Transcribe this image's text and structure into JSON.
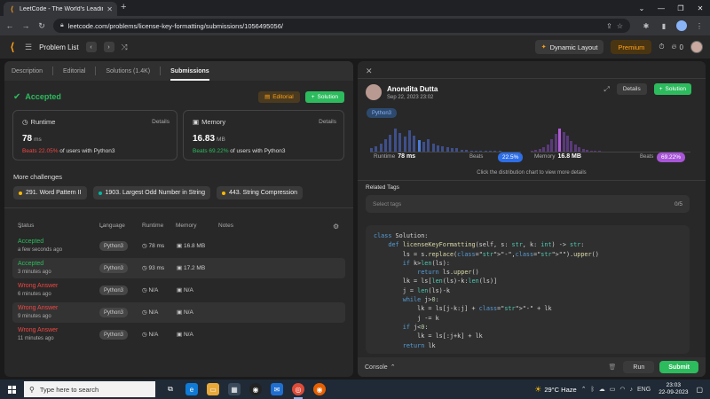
{
  "browser": {
    "tab_title": "LeetCode - The World's Leading",
    "url": "leetcode.com/problems/license-key-formatting/submissions/1056495056/"
  },
  "header": {
    "problem_list": "Problem List",
    "dynamic_layout": "Dynamic Layout",
    "premium": "Premium",
    "streak": "0"
  },
  "left": {
    "tabs": [
      "Description",
      "Editorial",
      "Solutions (1.4K)",
      "Submissions"
    ],
    "status": "Accepted",
    "editorial_btn": "Editorial",
    "solution_btn": "Solution",
    "runtime": {
      "label": "Runtime",
      "details": "Details",
      "value": "78",
      "unit": "ms",
      "beats_pct": "Beats 22.05%",
      "beats_rest": "of users with Python3"
    },
    "memory": {
      "label": "Memory",
      "details": "Details",
      "value": "16.83",
      "unit": "MB",
      "beats_pct": "Beats 69.22%",
      "beats_rest": "of users with Python3"
    },
    "more_title": "More challenges",
    "challenges": [
      {
        "label": "291. Word Pattern II",
        "color": "#ffb800"
      },
      {
        "label": "1903. Largest Odd Number in String",
        "color": "#00b8a3"
      },
      {
        "label": "443. String Compression",
        "color": "#ffb800"
      }
    ],
    "table_headers": {
      "status": "Status",
      "language": "Language",
      "runtime": "Runtime",
      "memory": "Memory",
      "notes": "Notes"
    },
    "rows": [
      {
        "status": "Accepted",
        "time": "a few seconds ago",
        "lang": "Python3",
        "runtime": "78 ms",
        "memory": "16.8 MB",
        "ok": "true"
      },
      {
        "status": "Accepted",
        "time": "3 minutes ago",
        "lang": "Python3",
        "runtime": "93 ms",
        "memory": "17.2 MB",
        "ok": "true"
      },
      {
        "status": "Wrong Answer",
        "time": "6 minutes ago",
        "lang": "Python3",
        "runtime": "N/A",
        "memory": "N/A",
        "ok": "false"
      },
      {
        "status": "Wrong Answer",
        "time": "9 minutes ago",
        "lang": "Python3",
        "runtime": "N/A",
        "memory": "N/A",
        "ok": "false"
      },
      {
        "status": "Wrong Answer",
        "time": "11 minutes ago",
        "lang": "Python3",
        "runtime": "N/A",
        "memory": "N/A",
        "ok": "false"
      }
    ]
  },
  "right": {
    "author": "Anondita Dutta",
    "date": "Sep 22, 2023 23:02",
    "details_btn": "Details",
    "solution_btn": "Solution",
    "lang_badge": "Python3",
    "runtime_label": "Runtime",
    "runtime_value": "78 ms",
    "runtime_beats_label": "Beats",
    "runtime_beats": "22.5%",
    "memory_label": "Memory",
    "memory_value": "16.8 MB",
    "memory_beats_label": "Beats",
    "memory_beats": "69.22%",
    "click_note": "Click the distribution chart to view more details",
    "related_tags": "Related Tags",
    "tags_placeholder": "Select tags",
    "tags_count": "0/5",
    "console": "Console",
    "run": "Run",
    "submit": "Submit",
    "runtime_dist": [
      3,
      5,
      8,
      12,
      16,
      22,
      18,
      14,
      20,
      15,
      11,
      9,
      12,
      8,
      6,
      5,
      4,
      3,
      3,
      2,
      2,
      1,
      1,
      1,
      1,
      1,
      1,
      1
    ],
    "runtime_highlight": 10,
    "memory_dist": [
      1,
      2,
      3,
      5,
      8,
      14,
      20,
      26,
      22,
      18,
      12,
      8,
      5,
      3,
      2,
      1,
      1,
      1
    ],
    "memory_highlight": 7,
    "code_lines": [
      "class Solution:",
      "    def licenseKeyFormatting(self, s: str, k: int) -> str:",
      "        ls = s.replace(\"-\",\"\").upper()",
      "        if k>len(ls):",
      "            return ls.upper()",
      "        lk = ls[len(ls)-k:len(ls)]",
      "        j = len(ls)-k",
      "        while j>0:",
      "            lk = ls[j-k:j] + \"-\" + lk",
      "            j -= k",
      "        if j<0:",
      "            lk = ls[:j+k] + lk",
      "        return lk"
    ]
  },
  "taskbar": {
    "search_placeholder": "Type here to search",
    "weather": "29°C  Haze",
    "lang": "ENG",
    "time": "23:03",
    "date": "22-09-2023"
  },
  "colors": {
    "accent_green": "#2cbb5d",
    "accent_orange": "#ffa116",
    "wrong_red": "#ef4743",
    "runtime_bar": "#3e4f8a",
    "runtime_bar_hi": "#4a7bd8",
    "memory_bar": "#5a3a7a",
    "memory_bar_hi": "#b05bd8"
  }
}
